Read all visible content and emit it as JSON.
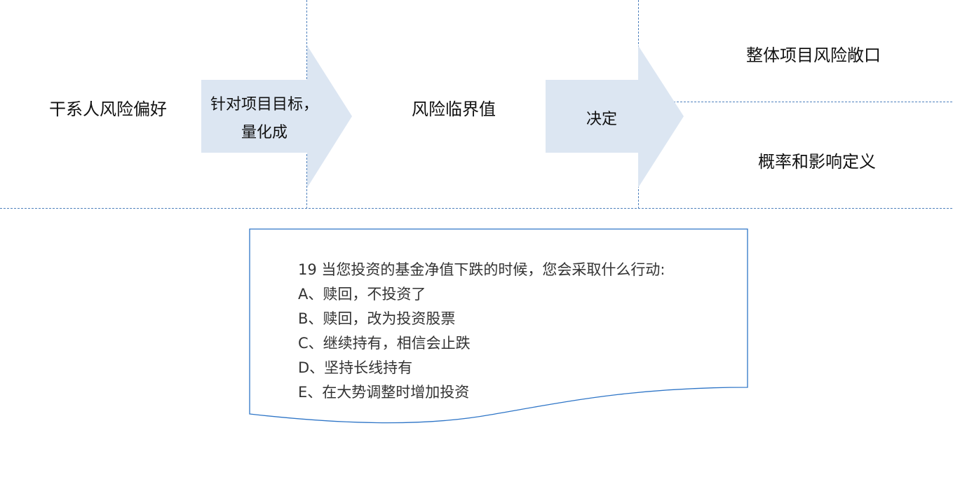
{
  "diagram": {
    "stakeholder_risk_appetite": "干系人风险偏好",
    "arrow1_label_line1": "针对项目目标，",
    "arrow1_label_line2": "量化成",
    "risk_threshold": "风险临界值",
    "arrow2_label": "决定",
    "overall_risk_exposure": "整体项目风险敞口",
    "probability_impact_definition": "概率和影响定义"
  },
  "question": {
    "title": "19 当您投资的基金净值下跌的时候，您会采取什么行动:",
    "options": [
      "A、赎回，不投资了",
      "B、赎回，改为投资股票",
      "C、继续持有，相信会止跌",
      "D、坚持长线持有",
      "E、在大势调整时增加投资"
    ]
  },
  "colors": {
    "arrow_fill": "#dce6f2",
    "line": "#4f81bd",
    "doc_border": "#2e75c7"
  }
}
